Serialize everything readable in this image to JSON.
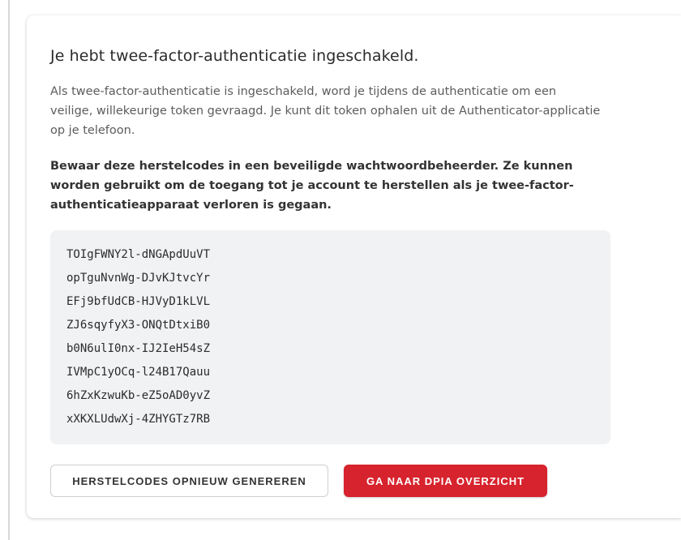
{
  "panel": {
    "title": "Je hebt twee-factor-authenticatie ingeschakeld.",
    "intro": "Als twee-factor-authenticatie is ingeschakeld, word je tijdens de authenticatie om een veilige, willekeurige token gevraagd. Je kunt dit token ophalen uit de Authenticator-applicatie op je telefoon.",
    "warning": "Bewaar deze herstelcodes in een beveiligde wachtwoordbeheerder. Ze kunnen worden gebruikt om de toegang tot je account te herstellen als je twee-factor-authenticatieapparaat verloren is gegaan."
  },
  "recovery_codes": [
    "TOIgFWNY2l-dNGApdUuVT",
    "opTguNvnWg-DJvKJtvcYr",
    "EFj9bfUdCB-HJVyD1kLVL",
    "ZJ6sqyfyX3-ONQtDtxiB0",
    "b0N6ulI0nx-IJ2IeH54sZ",
    "IVMpC1yOCq-l24B17Qauu",
    "6hZxKzwuKb-eZ5oAD0yvZ",
    "xXKXLUdwXj-4ZHYGTz7RB"
  ],
  "actions": {
    "regenerate_label": "HERSTELCODES OPNIEUW GENEREREN",
    "dpia_label": "GA NAAR DPIA OVERZICHT"
  },
  "colors": {
    "primary": "#d7232d",
    "codes_background": "#f1f2f4"
  }
}
